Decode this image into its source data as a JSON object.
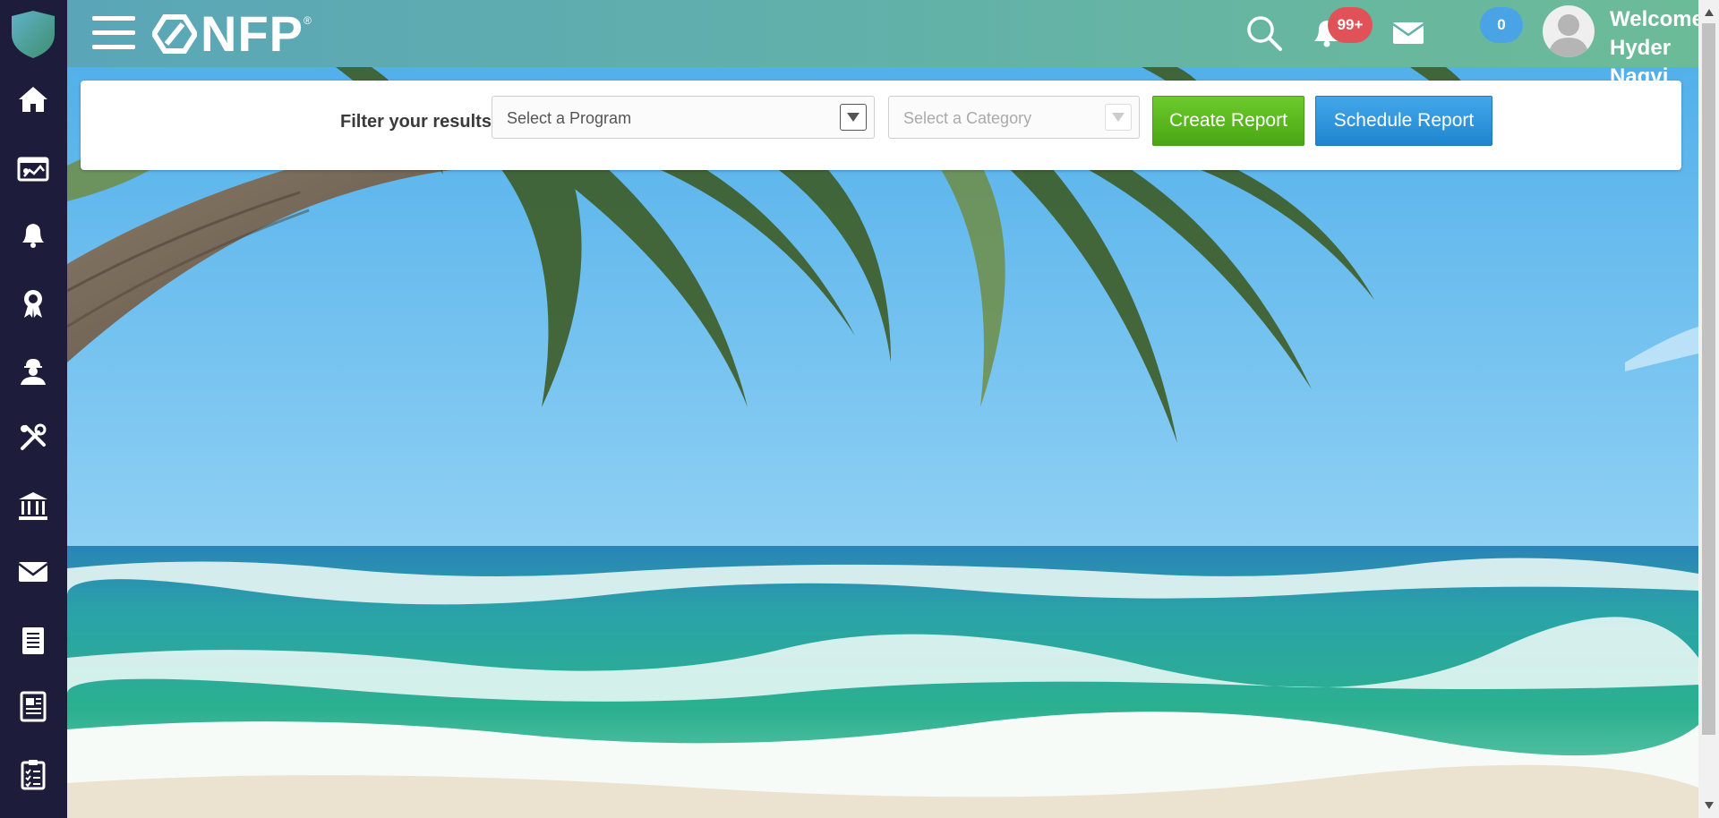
{
  "header": {
    "logo_text": "NFP",
    "logo_reg": "®",
    "notification_count": "99+",
    "message_count": "0",
    "welcome_line1": "Welcome",
    "welcome_line2": "Hyder Naqvi"
  },
  "sidebar": {
    "icons": [
      "home-icon",
      "dashboard-icon",
      "alerts-bell-icon",
      "award-icon",
      "worker-icon",
      "tools-icon",
      "bank-icon",
      "mail-icon",
      "notepad-icon",
      "document-icon",
      "clipboard-icon"
    ]
  },
  "filter": {
    "label": "Filter your results",
    "program_placeholder": "Select a Program",
    "category_placeholder": "Select a Category",
    "create_label": "Create Report",
    "schedule_label": "Schedule Report"
  },
  "colors": {
    "sidebar": "#1d1c3a",
    "header_start": "#5aa6b8",
    "header_end": "#6cbb98",
    "badge_red": "#e05257",
    "badge_blue": "#4aa3e5",
    "create_button": "#5ab720",
    "schedule_button": "#2c93dc"
  }
}
